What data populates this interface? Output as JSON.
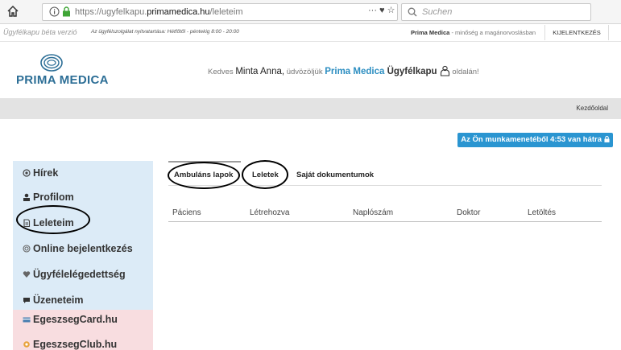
{
  "browser": {
    "url_prefix": "https://ugyfelkapu.",
    "url_domain": "primamedica.hu",
    "url_path": "/leleteim",
    "actions": "··· ♥ ☆",
    "search_placeholder": "Suchen"
  },
  "infobar": {
    "beta": "Ügyfélkapu béta verzió",
    "hours": "Az ügyfélszolgálat nyitvatartása: Hétfőtől - péntekig 8:00 - 20:00",
    "brand": "Prima Medica",
    "tagline": " - minőség a magánorvoslásban",
    "logout": "KIJELENTKEZÉS"
  },
  "header": {
    "logo_text": "PRIMA MEDICA",
    "greet_pre": "Kedves ",
    "user_name": "Minta Anna,",
    "greet_mid": " üdvözöljük ",
    "brand": "Prima Medica",
    "portal": " Ügyfélkapu ",
    "greet_post": " oldalán!"
  },
  "nav": {
    "home": "Kezdőoldal"
  },
  "session": {
    "text": "Az Ön munkamenetéből 4:53 van hátra"
  },
  "sidebar": {
    "items": [
      {
        "label": "Hírek",
        "icon": "globe-icon"
      },
      {
        "label": "Profilom",
        "icon": "user-icon"
      },
      {
        "label": "Leleteim",
        "icon": "document-icon"
      },
      {
        "label": "Online bejelentkezés",
        "icon": "clock-icon"
      },
      {
        "label": "Ügyfélelégedettség",
        "icon": "heart-icon"
      },
      {
        "label": "Üzeneteim",
        "icon": "chat-icon"
      },
      {
        "label": "EgeszsegCard.hu",
        "icon": "card-icon"
      },
      {
        "label": "EgeszsegClub.hu",
        "icon": "club-icon"
      }
    ]
  },
  "tabs": [
    "Ambuláns lapok",
    "Leletek",
    "Saját dokumentumok"
  ],
  "table": {
    "columns": [
      "Páciens",
      "Létrehozva",
      "Naplószám",
      "Doktor",
      "Letöltés"
    ]
  },
  "colors": {
    "accent": "#2a95d1",
    "brand_blue": "#2c6e96",
    "sidebar_blue": "#dcebf7",
    "sidebar_pink": "#f8dde0"
  }
}
